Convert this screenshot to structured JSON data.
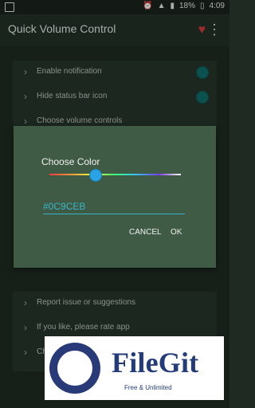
{
  "status_bar": {
    "battery": "18%",
    "time": "4:09"
  },
  "app_bar": {
    "title": "Quick Volume Control"
  },
  "settings": {
    "items": [
      {
        "label": "Enable notification"
      },
      {
        "label": "Hide status bar icon"
      },
      {
        "label": "Choose volume controls"
      },
      {
        "label": "Report issue or suggestions"
      },
      {
        "label": "If you like, please rate app"
      },
      {
        "label": "Ch"
      }
    ]
  },
  "dialog": {
    "title": "Choose Color",
    "hex_value": "#0C9CEB",
    "cancel_label": "CANCEL",
    "ok_label": "OK"
  },
  "watermark": {
    "brand": "FileGit",
    "tagline": "Free & Unlimited"
  },
  "colors": {
    "accent": "#0C9CEB",
    "dialog_bg": "#3F5B45",
    "teal": "#39B5C7"
  }
}
